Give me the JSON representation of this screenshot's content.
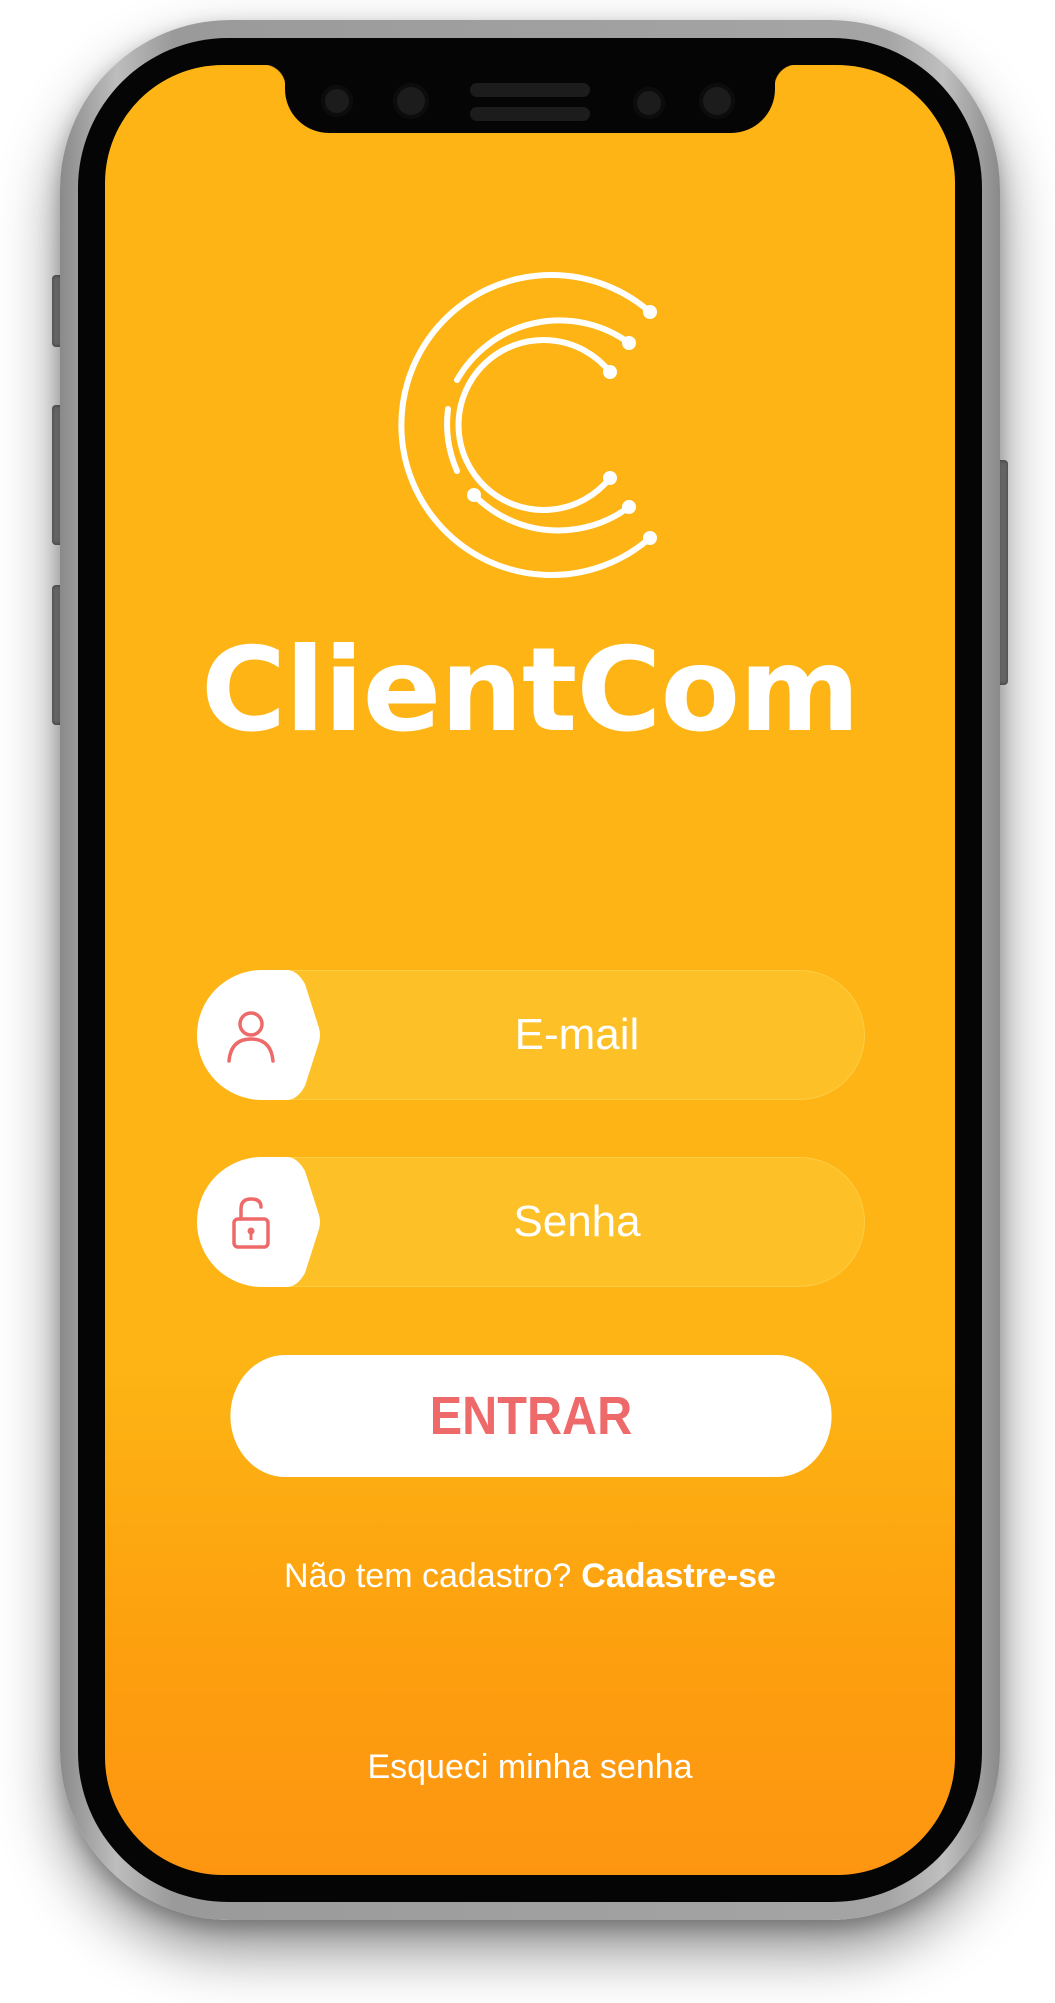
{
  "app": {
    "brand_name": "ClientCom",
    "logo_icon": "concentric-c-logo-icon"
  },
  "login_form": {
    "email": {
      "placeholder": "E-mail",
      "value": "",
      "icon": "user-icon"
    },
    "password": {
      "placeholder": "Senha",
      "value": "",
      "icon": "padlock-icon"
    },
    "submit_label": "ENTRAR"
  },
  "signup": {
    "prompt": "Não tem cadastro?",
    "link_label": "Cadastre-se"
  },
  "forgot_password_label": "Esqueci minha senha",
  "colors": {
    "background_top": "#fdb414",
    "background_bottom": "#fd9511",
    "accent": "#ee6a6a",
    "text": "#ffffff"
  }
}
